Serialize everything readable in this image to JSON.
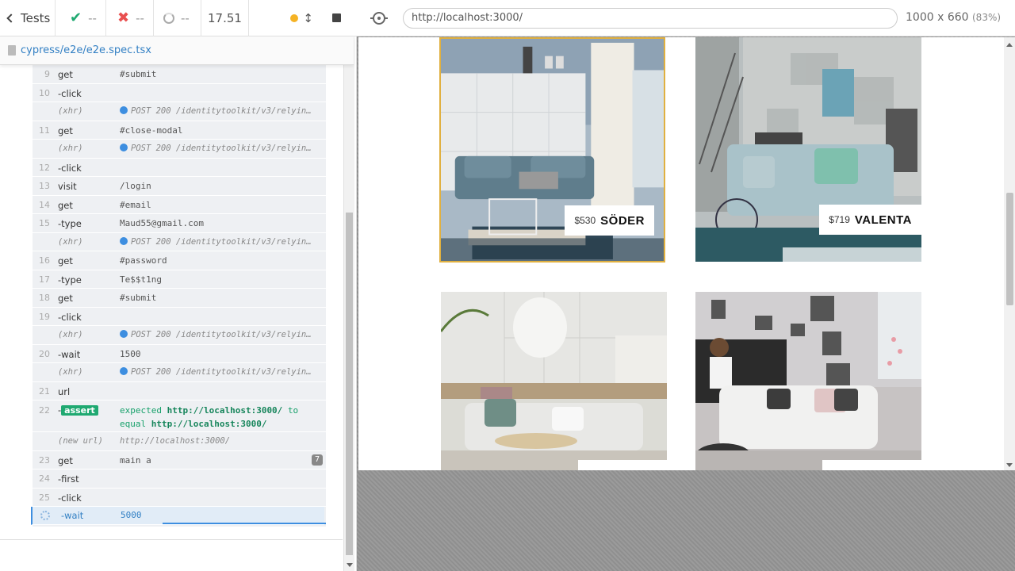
{
  "topbar": {
    "tests_label": "Tests",
    "passed": "--",
    "failed": "--",
    "pending": "--",
    "duration": "17.51"
  },
  "spec": {
    "path": "cypress/e2e/e2e.spec.tsx"
  },
  "log": [
    {
      "num": "9",
      "cmd": "get",
      "arg": "#submit"
    },
    {
      "num": "10",
      "cmd": "-click",
      "arg": ""
    },
    {
      "num": "",
      "cmd": "(xhr)",
      "arg": "POST 200 /identitytoolkit/v3/relyin…",
      "event": true
    },
    {
      "num": "11",
      "cmd": "get",
      "arg": "#close-modal"
    },
    {
      "num": "",
      "cmd": "(xhr)",
      "arg": "POST 200 /identitytoolkit/v3/relyin…",
      "event": true
    },
    {
      "num": "12",
      "cmd": "-click",
      "arg": ""
    },
    {
      "num": "13",
      "cmd": "visit",
      "arg": "/login"
    },
    {
      "num": "14",
      "cmd": "get",
      "arg": "#email"
    },
    {
      "num": "15",
      "cmd": "-type",
      "arg": "Maud55@gmail.com"
    },
    {
      "num": "",
      "cmd": "(xhr)",
      "arg": "POST 200 /identitytoolkit/v3/relyin…",
      "event": true
    },
    {
      "num": "16",
      "cmd": "get",
      "arg": "#password"
    },
    {
      "num": "17",
      "cmd": "-type",
      "arg": "Te$$t1ng"
    },
    {
      "num": "18",
      "cmd": "get",
      "arg": "#submit"
    },
    {
      "num": "19",
      "cmd": "-click",
      "arg": ""
    },
    {
      "num": "",
      "cmd": "(xhr)",
      "arg": "POST 200 /identitytoolkit/v3/relyin…",
      "event": true
    },
    {
      "num": "20",
      "cmd": "-wait",
      "arg": "1500"
    },
    {
      "num": "",
      "cmd": "(xhr)",
      "arg": "POST 200 /identitytoolkit/v3/relyin…",
      "event": true
    },
    {
      "num": "21",
      "cmd": "url",
      "arg": ""
    }
  ],
  "assert_row": {
    "num": "22",
    "badge": "assert",
    "word_expected": "expected",
    "actual": "http://localhost:3000/",
    "word_to": "to",
    "word_equal": "equal",
    "expected": "http://localhost:3000/"
  },
  "log_tail": [
    {
      "num": "",
      "cmd": "(new url)",
      "arg": "http://localhost:3000/",
      "event": true
    },
    {
      "num": "23",
      "cmd": "get",
      "arg": "main a",
      "badge": "7"
    },
    {
      "num": "24",
      "cmd": "-first",
      "arg": ""
    },
    {
      "num": "25",
      "cmd": "-click",
      "arg": ""
    }
  ],
  "active_row": {
    "cmd": "-wait",
    "arg": "5000"
  },
  "aut": {
    "url": "http://localhost:3000/",
    "viewport": "1000 x 660",
    "scale": "(83%)"
  },
  "products": [
    {
      "price": "$530",
      "name": "SÖDER"
    },
    {
      "price": "$719",
      "name": "VALENTA"
    }
  ]
}
